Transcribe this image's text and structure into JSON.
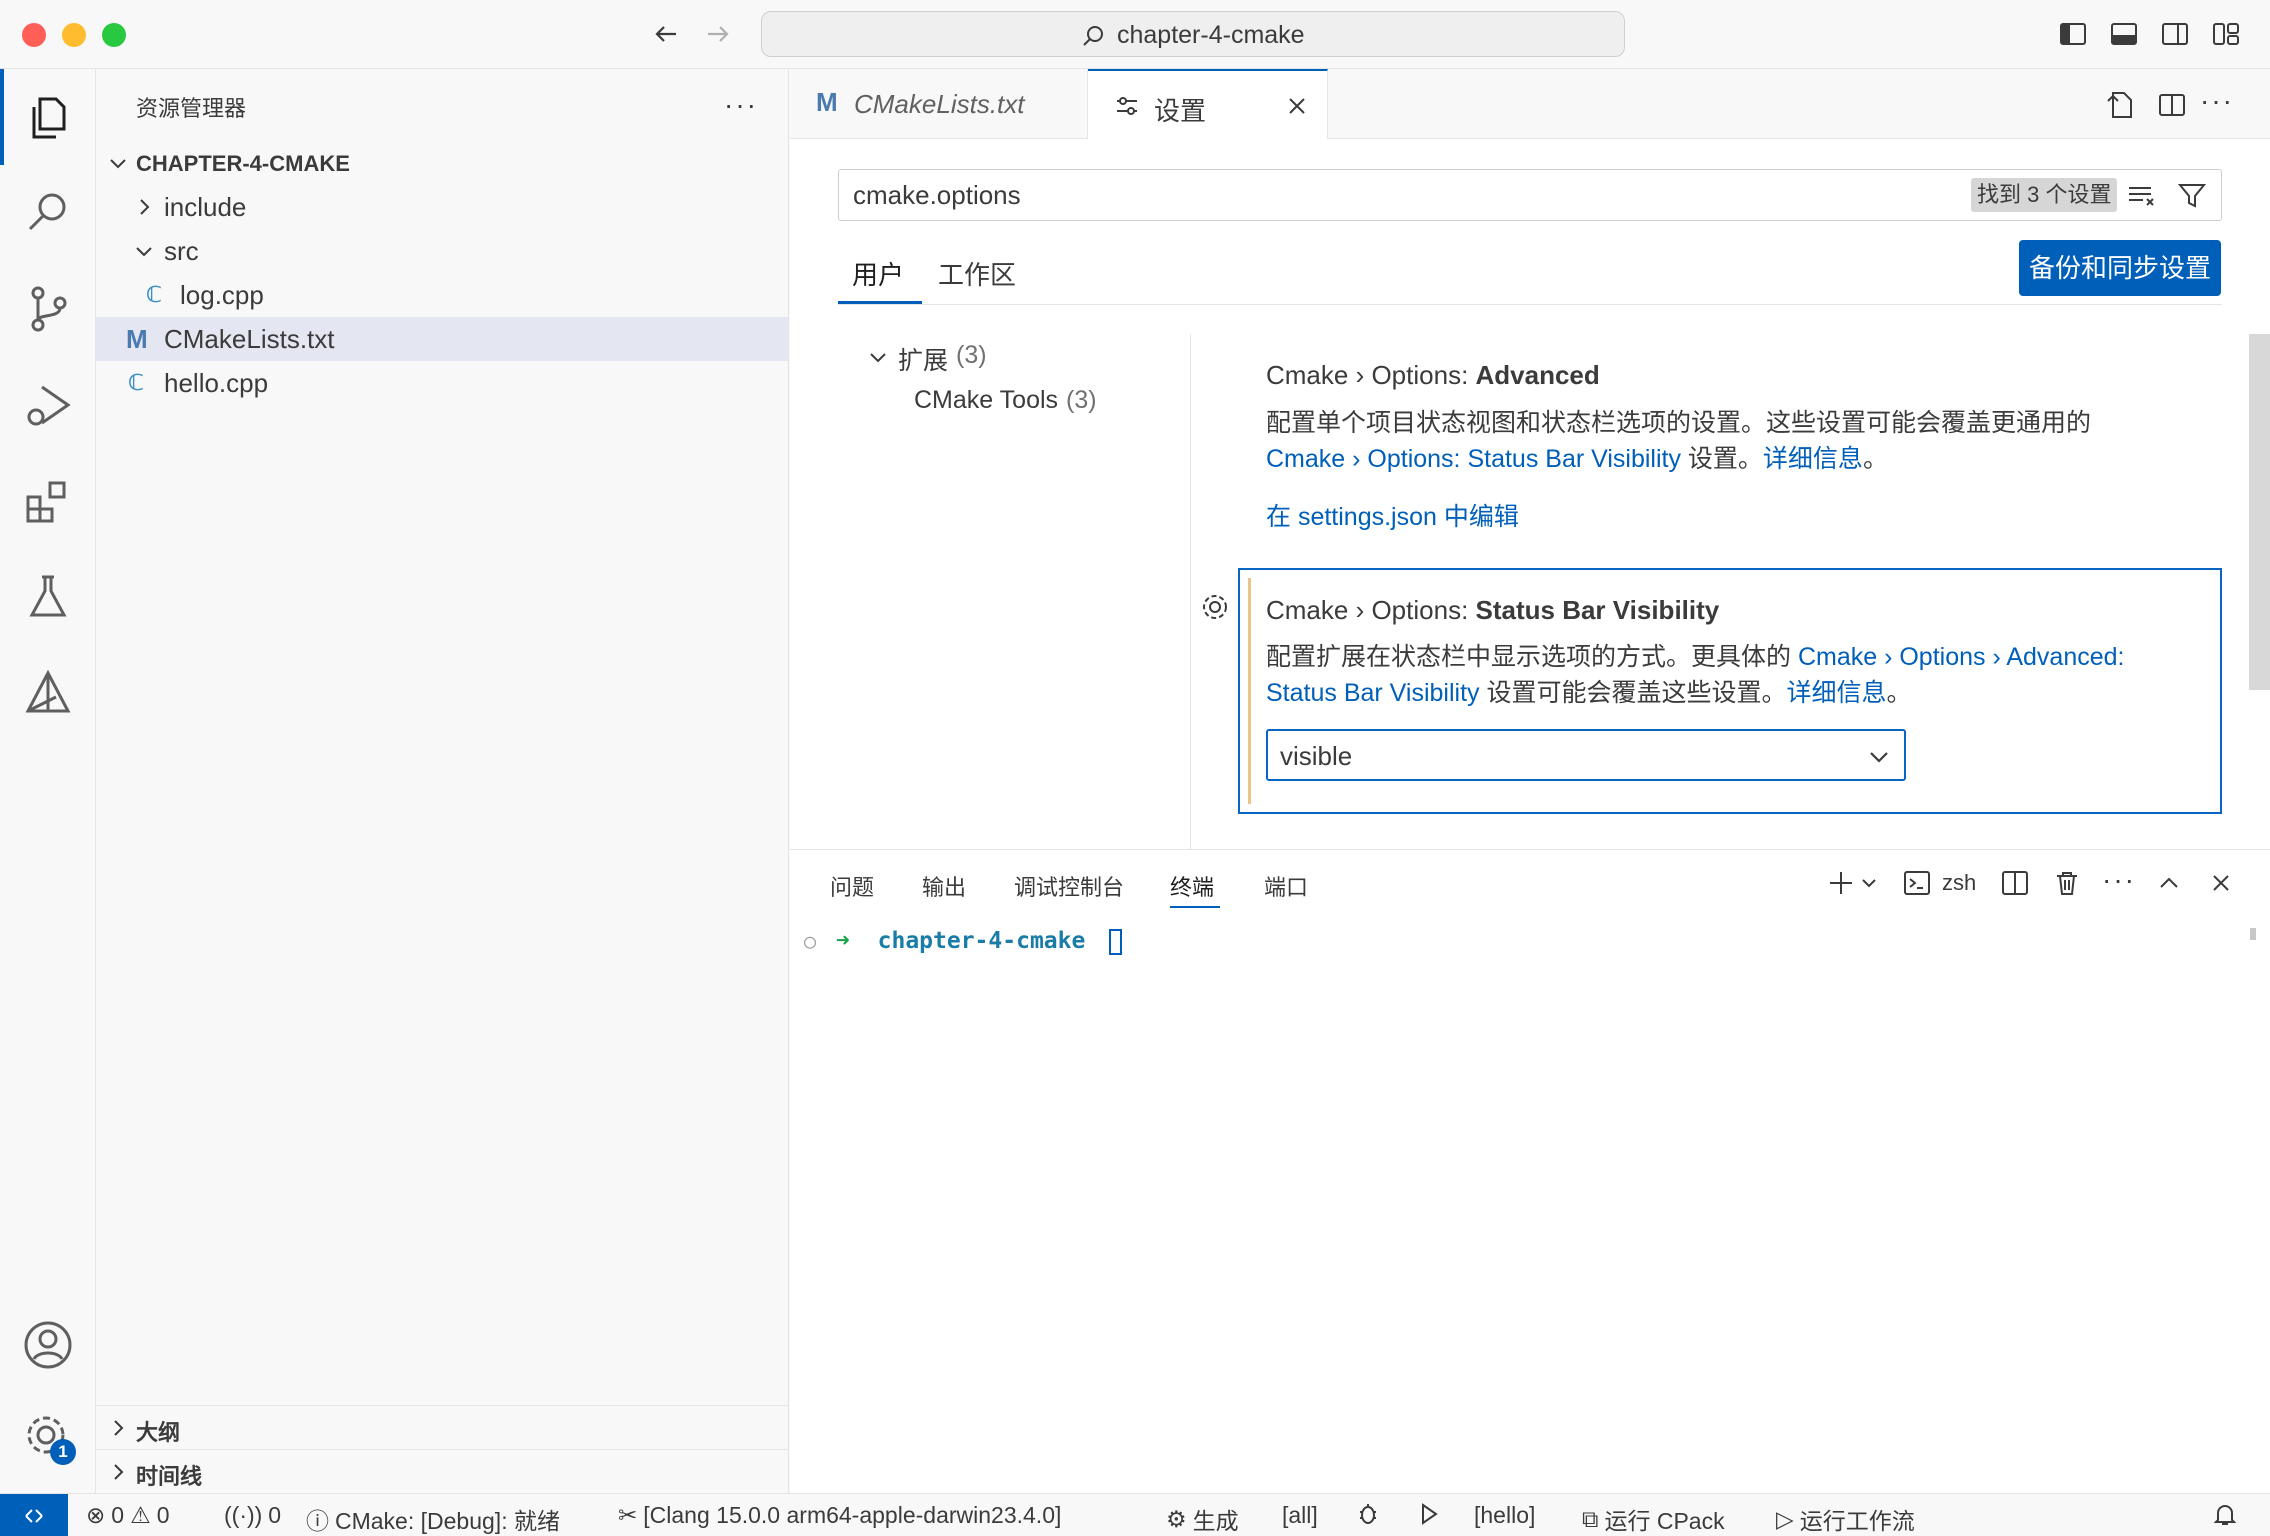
{
  "window": {
    "command_center_text": "chapter-4-cmake"
  },
  "activity_bar": {
    "items": [
      "explorer-icon",
      "search-icon",
      "source-control-icon",
      "run-debug-icon",
      "extensions-icon",
      "testing-icon",
      "cmake-icon"
    ],
    "account_icon": "account-icon",
    "settings_badge": "1"
  },
  "sidebar": {
    "title": "资源管理器",
    "more": "···",
    "root_folder": "CHAPTER-4-CMAKE",
    "tree": [
      {
        "label": "include",
        "type": "folder",
        "expanded": false
      },
      {
        "label": "src",
        "type": "folder",
        "expanded": true
      },
      {
        "label": "log.cpp",
        "type": "cpp"
      },
      {
        "label": "CMakeLists.txt",
        "type": "cmake",
        "selected": true
      },
      {
        "label": "hello.cpp",
        "type": "cpp"
      }
    ],
    "outline": "大纲",
    "timeline": "时间线"
  },
  "editor": {
    "tabs": [
      {
        "label": "CMakeLists.txt",
        "icon": "M"
      },
      {
        "label": "设置",
        "active": true
      }
    ],
    "search": {
      "value": "cmake.options",
      "found": "找到 3 个设置"
    },
    "scope_tabs": [
      "用户",
      "工作区"
    ],
    "backup_button": "备份和同步设置",
    "toc": {
      "group": "扩展",
      "group_count": "(3)",
      "item": "CMake Tools",
      "item_count": "(3)"
    },
    "settings": [
      {
        "prefix": "Cmake › Options: ",
        "name": "Advanced",
        "desc_1": "配置单个项目状态视图和状态栏选项的设置。这些设置可能会覆盖更通用的",
        "desc_link": "Cmake › Options: Status Bar Visibility",
        "desc_2": " 设置。",
        "more_link": "详细信息",
        "desc_end": "。",
        "edit_link": "在 settings.json 中编辑"
      },
      {
        "prefix": "Cmake › Options: ",
        "name": "Status Bar Visibility",
        "desc_1": "配置扩展在状态栏中显示选项的方式。更具体的 ",
        "desc_link_a": "Cmake › Options › Advanced:",
        "desc_link_b": "Status Bar Visibility",
        "desc_2": " 设置可能会覆盖这些设置。",
        "more_link": "详细信息",
        "desc_end": "。",
        "value": "visible"
      }
    ]
  },
  "panel": {
    "tabs": [
      "问题",
      "输出",
      "调试控制台",
      "终端",
      "端口"
    ],
    "active_tab": "终端",
    "terminal_name": "zsh",
    "prompt_dir": "chapter-4-cmake"
  },
  "statusbar": {
    "errors": "0",
    "warnings": "0",
    "ports": "0",
    "cmake_status": "CMake: [Debug]: 就绪",
    "kit": "[Clang 15.0.0 arm64-apple-darwin23.4.0]",
    "build": "生成",
    "target": "[all]",
    "launch_target": "[hello]",
    "cpack": "运行 CPack",
    "workflow": "运行工作流"
  },
  "colors": {
    "accent": "#005fb8",
    "modified": "#e9c48b",
    "selected_row": "#e4e6f1"
  }
}
